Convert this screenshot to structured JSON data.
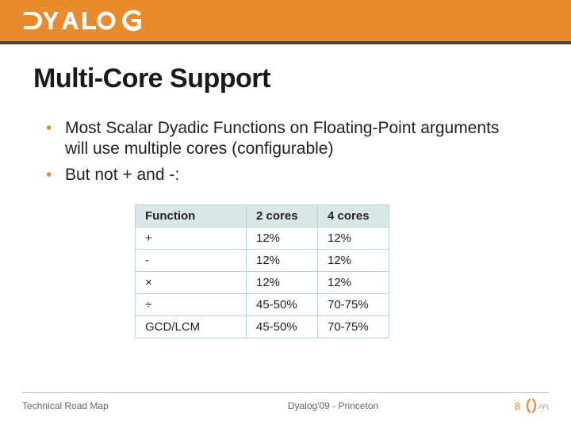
{
  "brand": {
    "name": "DYALOG"
  },
  "title": "Multi-Core Support",
  "bullets": [
    "Most Scalar Dyadic Functions on Floating-Point arguments will use multiple cores (configurable)",
    "But not + and -:"
  ],
  "table": {
    "headers": {
      "fn": "Function",
      "c2": "2 cores",
      "c4": "4 cores"
    },
    "rows": [
      {
        "fn": "+",
        "c2": "12%",
        "c4": "12%"
      },
      {
        "fn": "-",
        "c2": "12%",
        "c4": "12%"
      },
      {
        "fn": "×",
        "c2": "12%",
        "c4": "12%"
      },
      {
        "fn": "÷",
        "c2": "45-50%",
        "c4": "70-75%"
      },
      {
        "fn": "GCD/LCM",
        "c2": "45-50%",
        "c4": "70-75%"
      }
    ]
  },
  "footer": {
    "left": "Technical Road Map",
    "center": "Dyalog'09 - Princeton",
    "page": "8",
    "mark": "APL"
  },
  "chart_data": {
    "type": "table",
    "title": "Multi-Core Support",
    "columns": [
      "Function",
      "2 cores",
      "4 cores"
    ],
    "rows": [
      [
        "+",
        "12%",
        "12%"
      ],
      [
        "-",
        "12%",
        "12%"
      ],
      [
        "×",
        "12%",
        "12%"
      ],
      [
        "÷",
        "45-50%",
        "70-75%"
      ],
      [
        "GCD/LCM",
        "45-50%",
        "70-75%"
      ]
    ]
  }
}
